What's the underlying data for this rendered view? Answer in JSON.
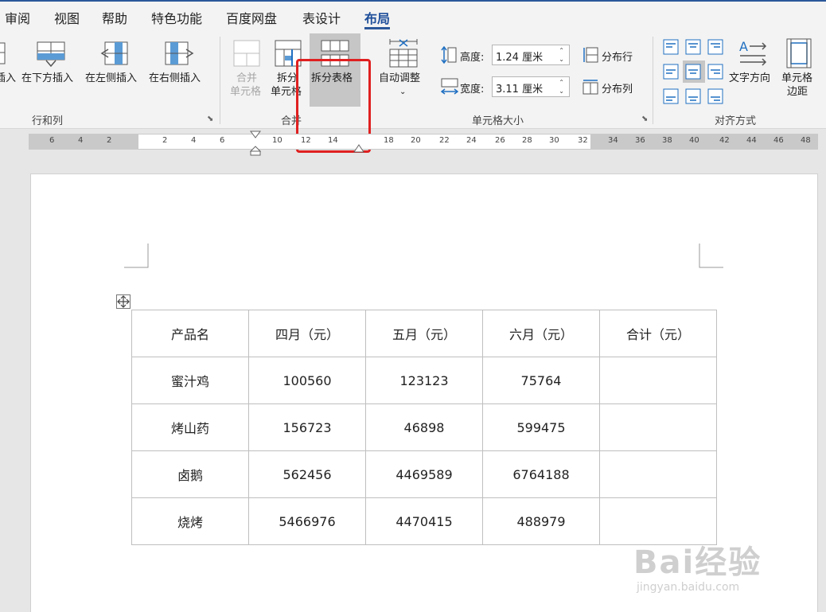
{
  "tabs": [
    {
      "label": "审阅"
    },
    {
      "label": "视图"
    },
    {
      "label": "帮助"
    },
    {
      "label": "特色功能"
    },
    {
      "label": "百度网盘"
    },
    {
      "label": "表设计"
    },
    {
      "label": "布局"
    }
  ],
  "ribbon": {
    "rows_cols": {
      "group_label": "行和列",
      "insert_above_partial": "插入",
      "insert_below": "在下方插入",
      "insert_left": "在左侧插入",
      "insert_right": "在右侧插入"
    },
    "merge": {
      "group_label": "合并",
      "merge_cells_line1": "合并",
      "merge_cells_line2": "单元格",
      "split_cells_line1": "拆分",
      "split_cells_line2": "单元格",
      "split_table": "拆分表格"
    },
    "cell_size": {
      "group_label": "单元格大小",
      "autofit": "自动调整",
      "height_label": "高度:",
      "height_value": "1.24 厘米",
      "width_label": "宽度:",
      "width_value": "3.11 厘米",
      "distribute_rows": "分布行",
      "distribute_cols": "分布列"
    },
    "alignment": {
      "group_label": "对齐方式",
      "text_direction": "文字方向",
      "cell_margins_line1": "单元格",
      "cell_margins_line2": "边距"
    }
  },
  "ruler": {
    "ticks": [
      "6",
      "4",
      "2",
      "2",
      "4",
      "6",
      "10",
      "12",
      "14",
      "18",
      "20",
      "22",
      "24",
      "26",
      "28",
      "30",
      "32",
      "34",
      "36",
      "38",
      "40",
      "42",
      "44",
      "46",
      "48"
    ]
  },
  "table": {
    "rows": [
      [
        "产品名",
        "四月（元）",
        "五月（元）",
        "六月（元）",
        "合计（元）"
      ],
      [
        "蜜汁鸡",
        "100560",
        "123123",
        "75764",
        ""
      ],
      [
        "烤山药",
        "156723",
        "46898",
        "599475",
        ""
      ],
      [
        "卤鹅",
        "562456",
        "4469589",
        "6764188",
        ""
      ],
      [
        "烧烤",
        "5466976",
        "4470415",
        "488979",
        ""
      ]
    ]
  },
  "watermark": {
    "brand": "Bai经验",
    "url": "jingyan.baidu.com"
  },
  "colors": {
    "accent": "#2b579a",
    "highlight": "#e02020",
    "icon_blue": "#1f6fc1"
  }
}
